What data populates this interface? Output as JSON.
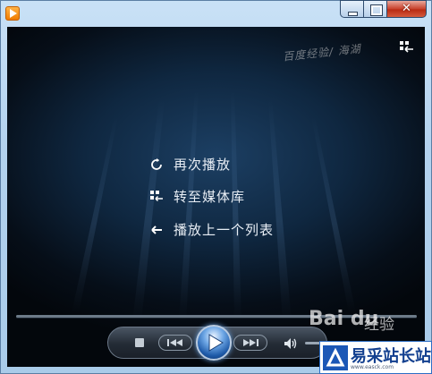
{
  "window": {
    "app_icon": "windows-media-player-icon",
    "caption_buttons": {
      "minimize": "minimize-icon",
      "maximize": "maximize-icon",
      "close_label": "✕"
    }
  },
  "video": {
    "watermark_text": "百度经验/ 海湖",
    "switch_view_icon": "switch-to-library-icon",
    "menu": [
      {
        "label": "再次播放",
        "icon": "replay-icon"
      },
      {
        "label": "转至媒体库",
        "icon": "library-icon"
      },
      {
        "label": "播放上一个列表",
        "icon": "back-arrow-icon"
      }
    ]
  },
  "controls": {
    "stop": "stop-icon",
    "previous": "previous-icon",
    "play": "play-icon",
    "next": "next-icon",
    "volume": "speaker-icon"
  },
  "watermarks": {
    "baidu_logo_text": "Bai du",
    "baidu_jingyan": "经验",
    "site_name": "易采站长站",
    "site_url": "www.easck.com"
  }
}
